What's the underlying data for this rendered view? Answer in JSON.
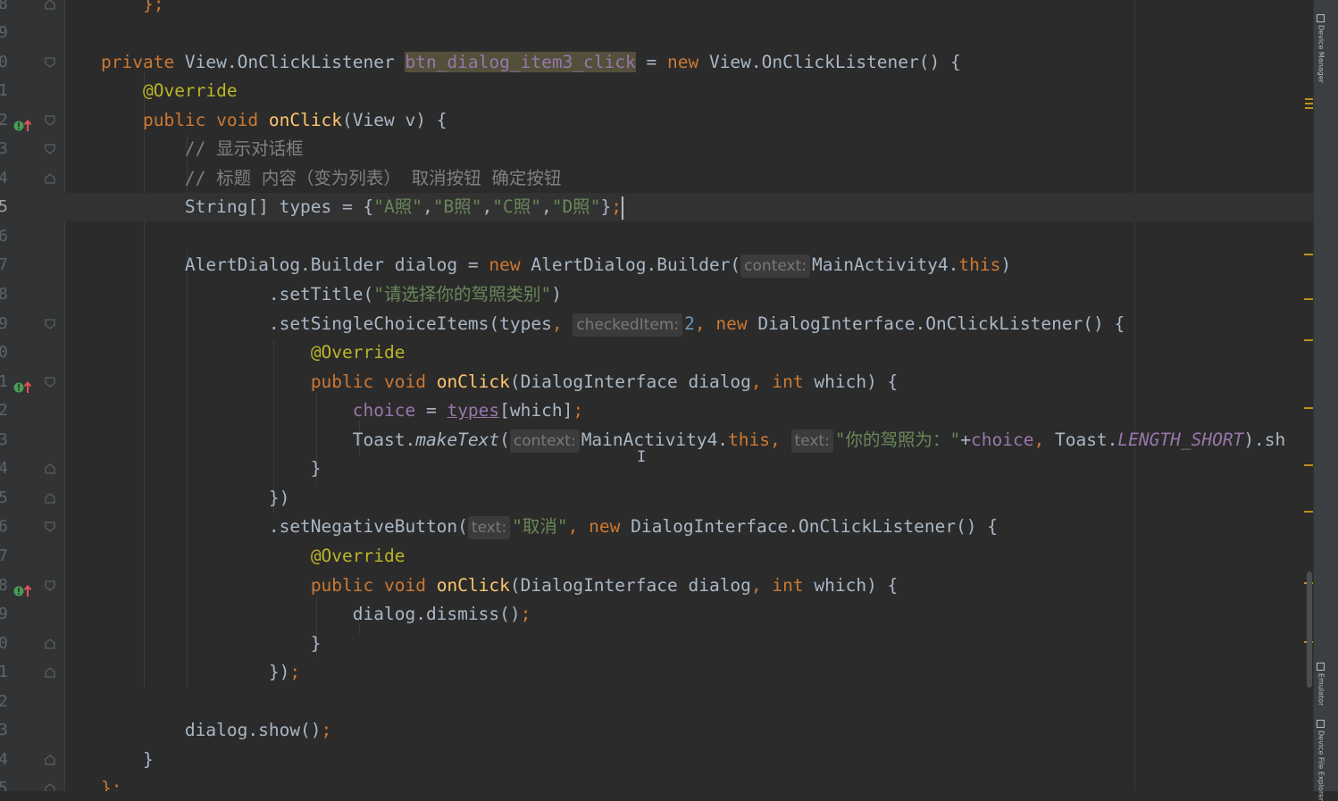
{
  "tool_window_tabs": [
    "Device Manager",
    "Emulator",
    "Device File Explorer"
  ],
  "lines": [
    {
      "num": "8",
      "fold": "end",
      "parts": [
        {
          "t": "    "
        },
        {
          "t": "};",
          "c": "kw"
        }
      ]
    },
    {
      "num": "9",
      "parts": []
    },
    {
      "num": "0",
      "fold": "start",
      "parts": [
        {
          "t": "private ",
          "c": "kw"
        },
        {
          "t": "View.OnClickListener "
        },
        {
          "t": "btn_dialog_item3_click",
          "c": "hl"
        },
        {
          "t": " = "
        },
        {
          "t": "new ",
          "c": "kw"
        },
        {
          "t": "View.OnClickListener() {"
        }
      ]
    },
    {
      "num": "1",
      "parts": [
        {
          "t": "    "
        },
        {
          "t": "@Override",
          "c": "ann"
        }
      ]
    },
    {
      "num": "2",
      "impl": true,
      "fold": "start",
      "parts": [
        {
          "t": "    "
        },
        {
          "t": "public void ",
          "c": "kw"
        },
        {
          "t": "onClick",
          "c": "fn"
        },
        {
          "t": "(View v) {"
        }
      ]
    },
    {
      "num": "3",
      "fold": "start",
      "parts": [
        {
          "t": "        "
        },
        {
          "t": "// 显示对话框",
          "c": "cm"
        }
      ]
    },
    {
      "num": "4",
      "fold": "end",
      "parts": [
        {
          "t": "        "
        },
        {
          "t": "// 标题 内容（变为列表） 取消按钮 确定按钮",
          "c": "cm"
        }
      ]
    },
    {
      "num": "5",
      "current": true,
      "parts": [
        {
          "t": "        String[] types = {"
        },
        {
          "t": "\"A照\"",
          "c": "str"
        },
        {
          "t": ","
        },
        {
          "t": "\"B照\"",
          "c": "str"
        },
        {
          "t": ","
        },
        {
          "t": "\"C照\"",
          "c": "str"
        },
        {
          "t": ","
        },
        {
          "t": "\"D照\"",
          "c": "str"
        },
        {
          "t": "}"
        },
        {
          "t": ";",
          "c": "kw"
        },
        {
          "caret": true
        }
      ]
    },
    {
      "num": "6",
      "parts": []
    },
    {
      "num": "7",
      "parts": [
        {
          "t": "        AlertDialog.Builder dialog = "
        },
        {
          "t": "new ",
          "c": "kw"
        },
        {
          "t": "AlertDialog.Builder("
        },
        {
          "hint": "context:"
        },
        {
          "t": "MainActivity4."
        },
        {
          "t": "this",
          "c": "kw"
        },
        {
          "t": ")"
        }
      ]
    },
    {
      "num": "8",
      "parts": [
        {
          "t": "                .setTitle("
        },
        {
          "t": "\"请选择你的驾照类别\"",
          "c": "str"
        },
        {
          "t": ")"
        }
      ]
    },
    {
      "num": "9",
      "fold": "start",
      "parts": [
        {
          "t": "                .setSingleChoiceItems(types"
        },
        {
          "t": ", ",
          "c": "kw"
        },
        {
          "hint": "checkedItem:"
        },
        {
          "t": "2",
          "c": "num"
        },
        {
          "t": ", ",
          "c": "kw"
        },
        {
          "t": "new ",
          "c": "kw"
        },
        {
          "t": "DialogInterface.OnClickListener() {"
        }
      ]
    },
    {
      "num": "0",
      "parts": [
        {
          "t": "                    "
        },
        {
          "t": "@Override",
          "c": "ann"
        }
      ]
    },
    {
      "num": "1",
      "impl": true,
      "fold": "start",
      "parts": [
        {
          "t": "                    "
        },
        {
          "t": "public void ",
          "c": "kw"
        },
        {
          "t": "onClick",
          "c": "fn"
        },
        {
          "t": "(DialogInterface dialog"
        },
        {
          "t": ", ",
          "c": "kw"
        },
        {
          "t": "int ",
          "c": "kw"
        },
        {
          "t": "which) {"
        }
      ]
    },
    {
      "num": "2",
      "parts": [
        {
          "t": "                        "
        },
        {
          "t": "choice",
          "c": "fld"
        },
        {
          "t": " = "
        },
        {
          "t": "types",
          "c": "fld ul"
        },
        {
          "t": "[which]"
        },
        {
          "t": ";",
          "c": "kw"
        }
      ]
    },
    {
      "num": "3",
      "parts": [
        {
          "t": "                        Toast."
        },
        {
          "t": "makeText",
          "c": "ital"
        },
        {
          "t": "("
        },
        {
          "hint": "context:"
        },
        {
          "t": "MainActivity4."
        },
        {
          "t": "this",
          "c": "kw"
        },
        {
          "t": ", ",
          "c": "kw"
        },
        {
          "hint": "text:"
        },
        {
          "t": "\"你的驾照为：\"",
          "c": "str"
        },
        {
          "t": "+"
        },
        {
          "t": "choice",
          "c": "fld"
        },
        {
          "t": ", ",
          "c": "kw"
        },
        {
          "t": "Toast."
        },
        {
          "t": "LENGTH_SHORT",
          "c": "fld ital"
        },
        {
          "t": ").sh"
        }
      ]
    },
    {
      "num": "4",
      "fold": "end",
      "parts": [
        {
          "t": "                    }"
        }
      ]
    },
    {
      "num": "5",
      "fold": "end",
      "parts": [
        {
          "t": "                })"
        }
      ]
    },
    {
      "num": "6",
      "fold": "start",
      "parts": [
        {
          "t": "                .setNegativeButton("
        },
        {
          "hint": "text:"
        },
        {
          "t": "\"取消\"",
          "c": "str"
        },
        {
          "t": ", ",
          "c": "kw"
        },
        {
          "t": "new ",
          "c": "kw"
        },
        {
          "t": "DialogInterface.OnClickListener() {"
        }
      ]
    },
    {
      "num": "7",
      "parts": [
        {
          "t": "                    "
        },
        {
          "t": "@Override",
          "c": "ann"
        }
      ]
    },
    {
      "num": "8",
      "impl": true,
      "fold": "start",
      "parts": [
        {
          "t": "                    "
        },
        {
          "t": "public void ",
          "c": "kw"
        },
        {
          "t": "onClick",
          "c": "fn"
        },
        {
          "t": "(DialogInterface dialog"
        },
        {
          "t": ", ",
          "c": "kw"
        },
        {
          "t": "int ",
          "c": "kw"
        },
        {
          "t": "which) {"
        }
      ]
    },
    {
      "num": "9",
      "parts": [
        {
          "t": "                        dialog.dismiss()"
        },
        {
          "t": ";",
          "c": "kw"
        }
      ]
    },
    {
      "num": "0",
      "fold": "end",
      "parts": [
        {
          "t": "                    }"
        }
      ]
    },
    {
      "num": "1",
      "fold": "end",
      "parts": [
        {
          "t": "                })"
        },
        {
          "t": ";",
          "c": "kw"
        }
      ]
    },
    {
      "num": "2",
      "parts": []
    },
    {
      "num": "3",
      "parts": [
        {
          "t": "        dialog.show()"
        },
        {
          "t": ";",
          "c": "kw"
        }
      ]
    },
    {
      "num": "4",
      "fold": "end",
      "parts": [
        {
          "t": "    }"
        }
      ]
    },
    {
      "num": "5",
      "fold": "end",
      "parts": [
        {
          "t": "};",
          "c": "kw"
        }
      ]
    }
  ],
  "colors": {
    "background": "#2b2b2b",
    "keyword": "#cc7832",
    "annotation": "#bbb529",
    "method": "#ffc66d",
    "string": "#6a8759",
    "comment": "#808080",
    "number": "#6897bb",
    "field": "#9876aa"
  }
}
